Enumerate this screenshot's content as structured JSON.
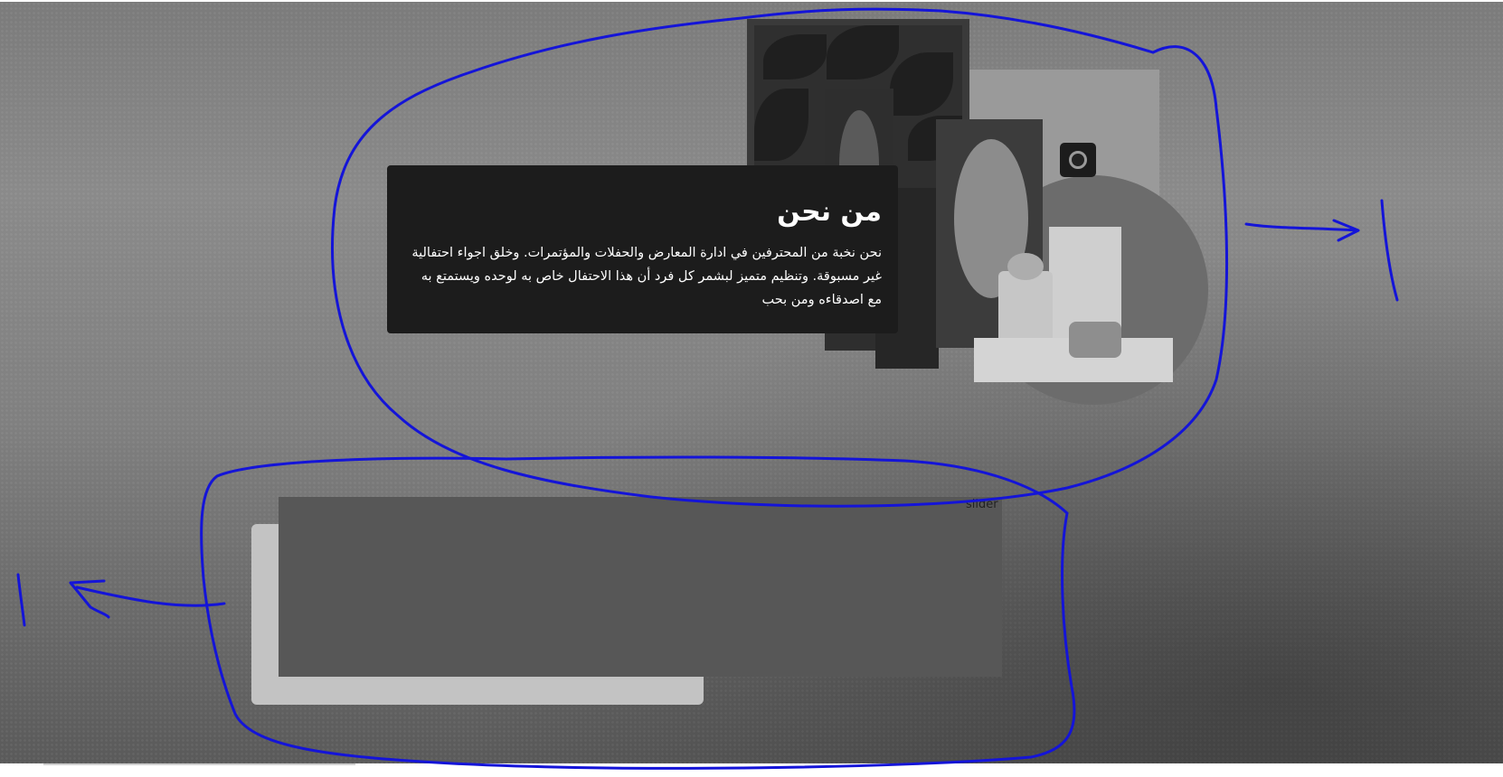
{
  "about": {
    "title": "من نحن",
    "text": "نحن نخبة من المحترفين في ادارة المعارض والحفلات والمؤتمرات. وخلق اجواء احتفالية غير مسبوقة. وتنظيم متميز لبشمر كل فرد أن هذا الاحتفال خاص به لوحده ويستمتع به مع اصدقاءه ومن بحب"
  },
  "slider": {
    "label": "slider"
  },
  "annotations": {
    "marker_right": "1",
    "marker_left": "1",
    "stroke_color": "#1414d8"
  },
  "colors": {
    "card_bg": "#1c1c1c",
    "slider_front": "#575757",
    "slider_back": "#c3c3c3"
  }
}
